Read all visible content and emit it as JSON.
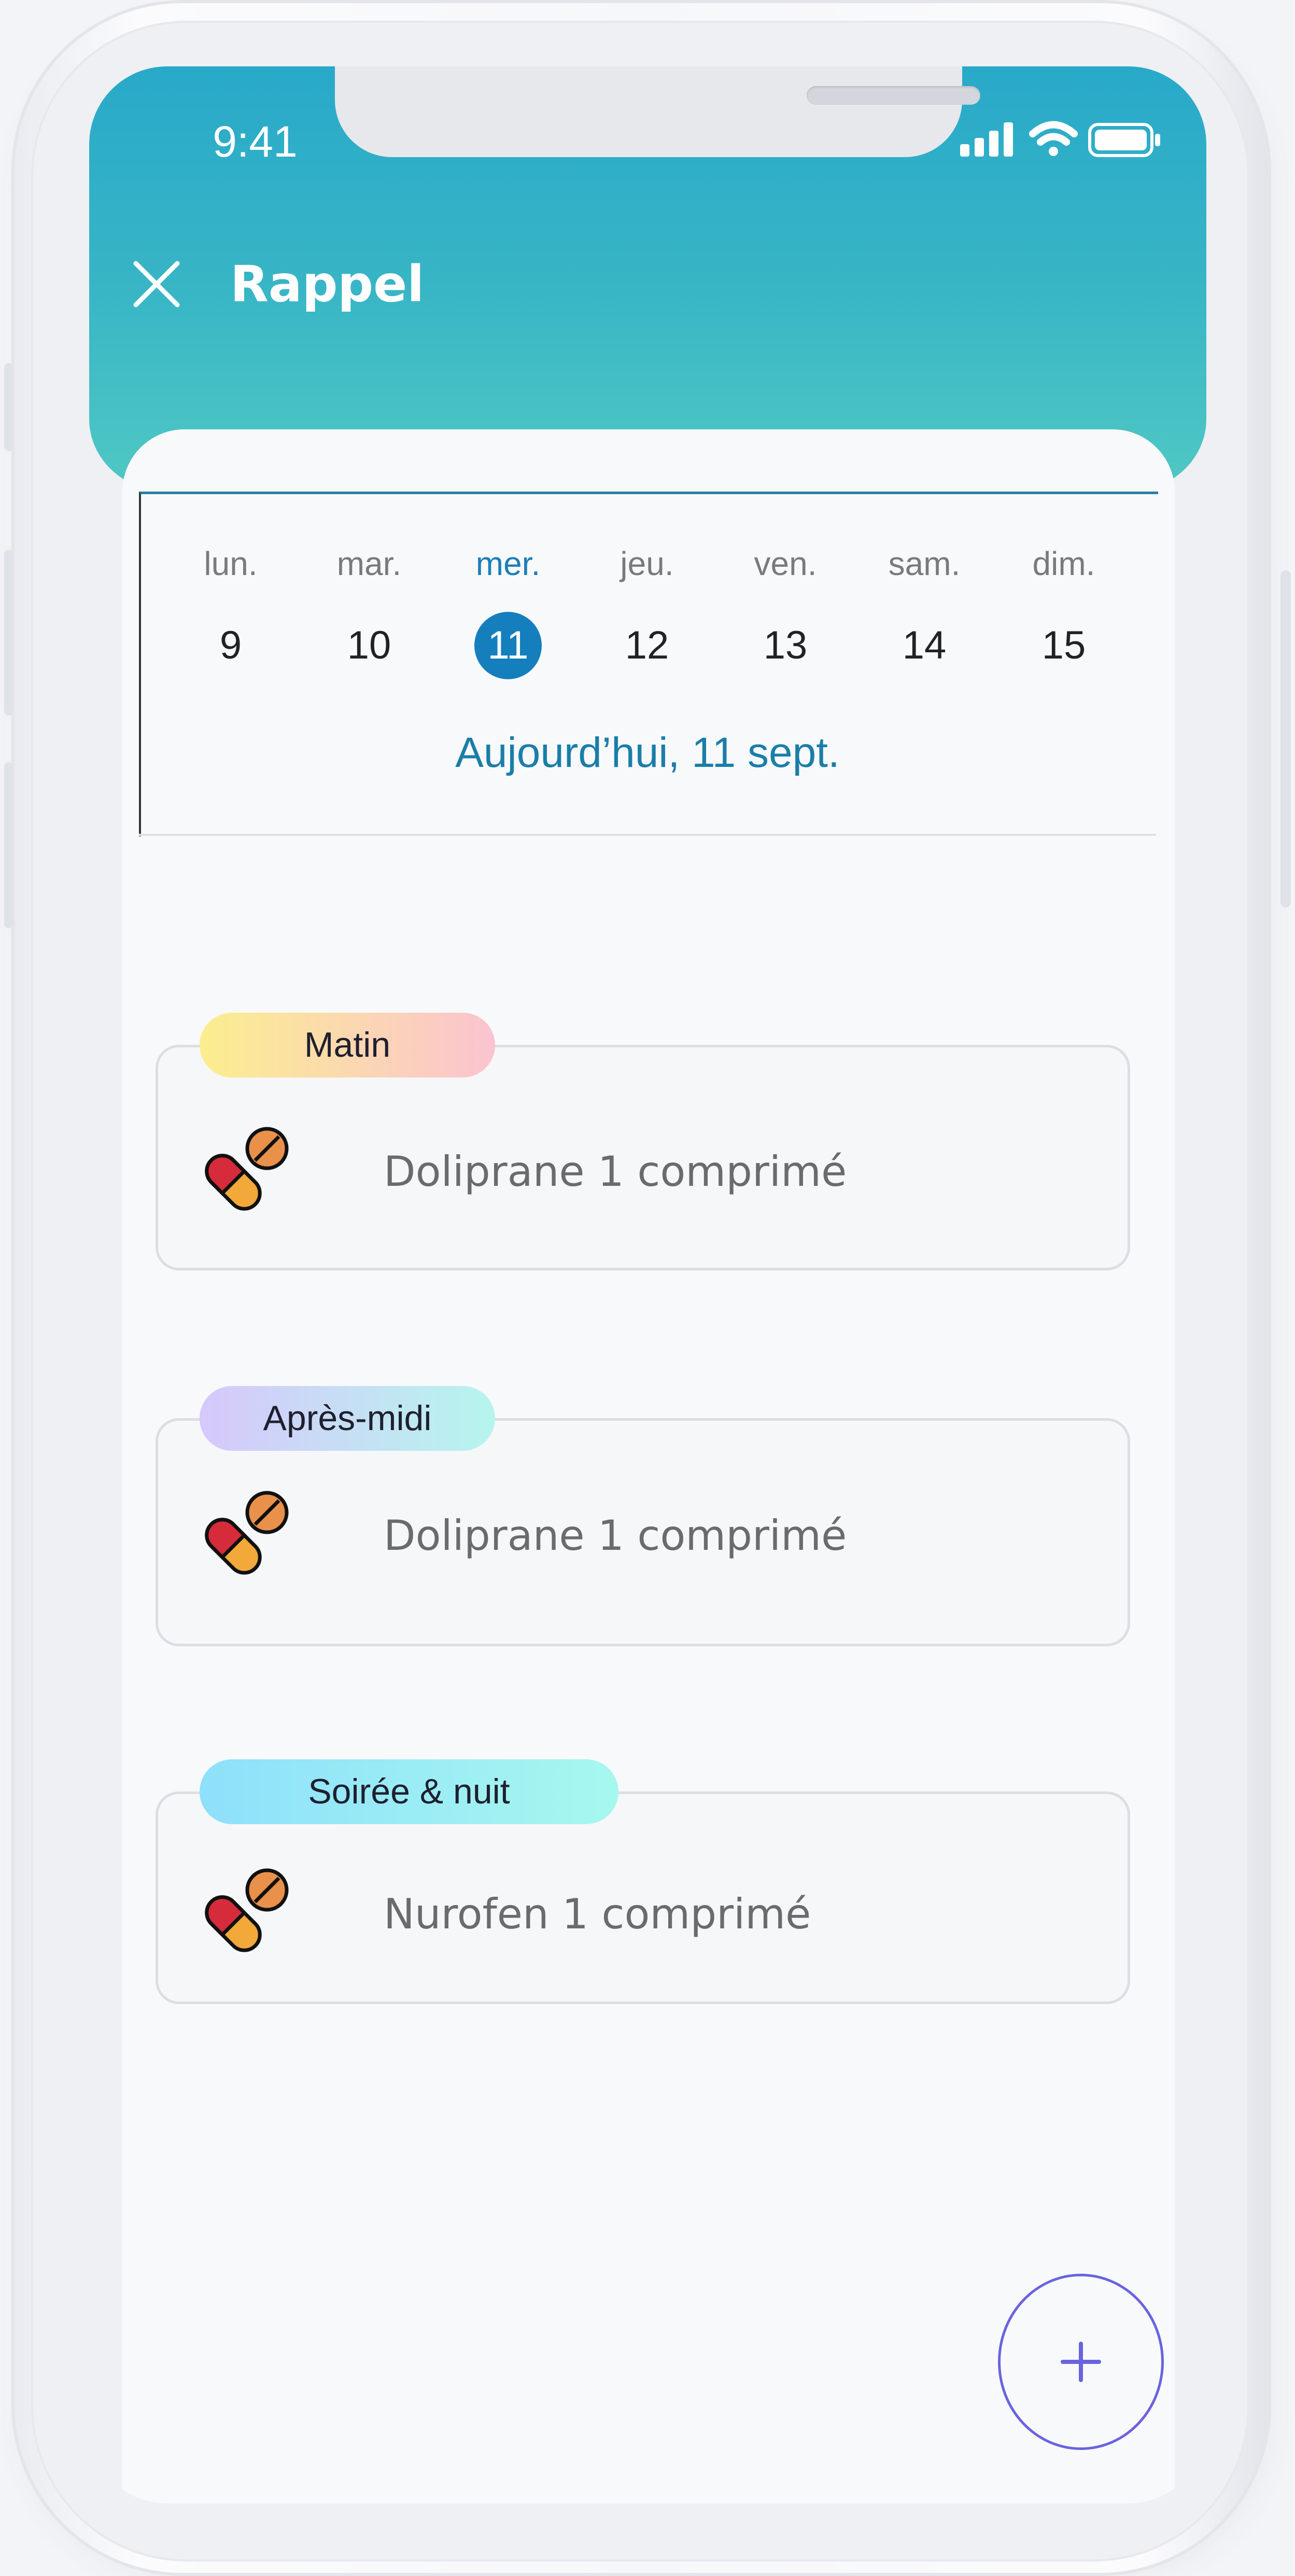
{
  "status_bar": {
    "time": "9:41",
    "icons": [
      "signal-icon",
      "wifi-icon",
      "battery-icon"
    ]
  },
  "header": {
    "title": "Rappel",
    "close_icon": "close-icon"
  },
  "calendar": {
    "days": [
      {
        "name": "lun.",
        "num": "9",
        "active": false
      },
      {
        "name": "mar.",
        "num": "10",
        "active": false
      },
      {
        "name": "mer.",
        "num": "11",
        "active": true
      },
      {
        "name": "jeu.",
        "num": "12",
        "active": false
      },
      {
        "name": "ven.",
        "num": "13",
        "active": false
      },
      {
        "name": "sam.",
        "num": "14",
        "active": false
      },
      {
        "name": "dim.",
        "num": "15",
        "active": false
      }
    ],
    "today_label": "Aujourd’hui, 11 sept."
  },
  "reminders": [
    {
      "period": "Matin",
      "medication": "Doliprane 1 comprimé",
      "icon": "pills-icon"
    },
    {
      "period": "Après-midi",
      "medication": "Doliprane 1 comprimé",
      "icon": "pills-icon"
    },
    {
      "period": "Soirée & nuit",
      "medication": "Nurofen 1 comprimé",
      "icon": "pills-icon"
    }
  ],
  "fab": {
    "label": "+",
    "icon": "plus-icon"
  },
  "colors": {
    "header_top": "#29a9c9",
    "header_bottom": "#50c8c3",
    "accent": "#157fbd",
    "fab_border": "#6a63df"
  }
}
